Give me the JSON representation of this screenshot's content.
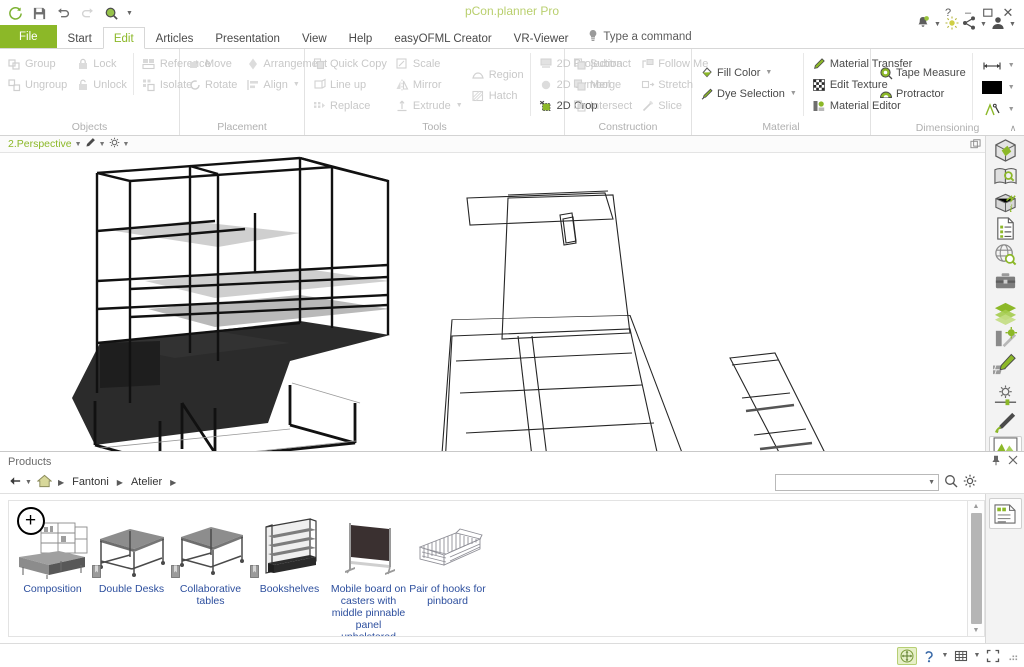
{
  "window": {
    "title": "pCon.planner Pro",
    "controls": {
      "help": "?",
      "minimize": "–",
      "maximize": "❐",
      "close": "✕"
    }
  },
  "quick_access": {
    "items": [
      {
        "name": "refresh-icon",
        "label": "Refresh"
      },
      {
        "name": "save-icon",
        "label": "Save"
      },
      {
        "name": "undo-icon",
        "label": "Undo"
      },
      {
        "name": "redo-icon",
        "label": "Redo"
      },
      {
        "name": "zoom-icon",
        "label": "Zoom"
      }
    ]
  },
  "account_bar": {
    "notifications": "Notifications",
    "tips": "Tips",
    "share": "Share",
    "account": "Account"
  },
  "tabs": [
    {
      "label": "File",
      "type": "file"
    },
    {
      "label": "Start",
      "type": "normal"
    },
    {
      "label": "Edit",
      "type": "active"
    },
    {
      "label": "Articles",
      "type": "normal"
    },
    {
      "label": "Presentation",
      "type": "normal"
    },
    {
      "label": "View",
      "type": "normal"
    },
    {
      "label": "Help",
      "type": "normal"
    },
    {
      "label": "easyOFML Creator",
      "type": "normal"
    },
    {
      "label": "VR-Viewer",
      "type": "normal"
    }
  ],
  "command_search": {
    "placeholder": "Type a command",
    "icon": "lightbulb-icon"
  },
  "ribbon": {
    "collapse_label": "∧",
    "groups": [
      {
        "title": "Objects",
        "columns": [
          {
            "items": [
              {
                "label": "Group",
                "icon": "group-icon",
                "disabled": true
              },
              {
                "label": "Ungroup",
                "icon": "ungroup-icon",
                "disabled": true
              }
            ]
          },
          {
            "items": [
              {
                "label": "Lock",
                "icon": "lock-icon",
                "disabled": true
              },
              {
                "label": "Unlock",
                "icon": "unlock-icon",
                "disabled": true
              }
            ]
          },
          {
            "sep": true,
            "items": [
              {
                "label": "Reference",
                "icon": "reference-icon",
                "disabled": true
              },
              {
                "label": "Isolate",
                "icon": "isolate-icon",
                "disabled": true
              }
            ]
          }
        ]
      },
      {
        "title": "Placement",
        "columns": [
          {
            "items": [
              {
                "label": "Move",
                "icon": "move-icon",
                "disabled": true
              },
              {
                "label": "Rotate",
                "icon": "rotate-icon",
                "disabled": true
              }
            ]
          },
          {
            "items": [
              {
                "label": "Arrangement",
                "icon": "arrangement-icon",
                "disabled": true
              },
              {
                "label": "Align",
                "icon": "align-icon",
                "disabled": true,
                "caret": true
              }
            ]
          }
        ]
      },
      {
        "title": "Tools",
        "columns": [
          {
            "items": [
              {
                "label": "Quick Copy",
                "icon": "quick-copy-icon",
                "disabled": true
              },
              {
                "label": "Line up",
                "icon": "line-up-icon",
                "disabled": true
              },
              {
                "label": "Replace",
                "icon": "replace-icon",
                "disabled": true
              }
            ]
          },
          {
            "items": [
              {
                "label": "Scale",
                "icon": "scale-icon",
                "disabled": true
              },
              {
                "label": "Mirror",
                "icon": "mirror-icon",
                "disabled": true
              },
              {
                "label": "Extrude",
                "icon": "extrude-icon",
                "disabled": true,
                "caret": true
              }
            ]
          },
          {
            "center": true,
            "items": [
              {
                "label": "Region",
                "icon": "region-icon",
                "disabled": true
              },
              {
                "label": "Hatch",
                "icon": "hatch-icon",
                "disabled": true
              }
            ]
          },
          {
            "sep": true,
            "items": [
              {
                "label": "2D Projection",
                "icon": "projection-icon",
                "disabled": true
              },
              {
                "label": "2D Symbol",
                "icon": "symbol-icon",
                "disabled": true
              },
              {
                "label": "2D Crop",
                "icon": "crop-icon",
                "disabled": false
              }
            ]
          }
        ]
      },
      {
        "title": "Construction",
        "columns": [
          {
            "items": [
              {
                "label": "Subtract",
                "icon": "subtract-icon",
                "disabled": true
              },
              {
                "label": "Merge",
                "icon": "merge-icon",
                "disabled": true
              },
              {
                "label": "Intersect",
                "icon": "intersect-icon",
                "disabled": true
              }
            ]
          },
          {
            "items": [
              {
                "label": "Follow Me",
                "icon": "follow-me-icon",
                "disabled": true
              },
              {
                "label": "Stretch",
                "icon": "stretch-icon",
                "disabled": true
              },
              {
                "label": "Slice",
                "icon": "slice-icon",
                "disabled": true
              }
            ]
          }
        ]
      },
      {
        "title": "Material",
        "columns": [
          {
            "center": true,
            "items": [
              {
                "label": "Fill Color",
                "icon": "fill-color-icon",
                "disabled": false,
                "caret": true
              },
              {
                "label": "Dye Selection",
                "icon": "dye-selection-icon",
                "disabled": false,
                "caret": true
              }
            ]
          },
          {
            "sep": true,
            "items": [
              {
                "label": "Material Transfer",
                "icon": "material-transfer-icon",
                "disabled": false
              },
              {
                "label": "Edit Texture",
                "icon": "edit-texture-icon",
                "disabled": false
              },
              {
                "label": "Material Editor",
                "icon": "material-editor-icon",
                "disabled": false
              }
            ]
          }
        ]
      },
      {
        "title": "Dimensioning",
        "columns": [
          {
            "center": true,
            "items": [
              {
                "label": "Tape Measure",
                "icon": "tape-measure-icon",
                "disabled": false
              },
              {
                "label": "Protractor",
                "icon": "protractor-icon",
                "disabled": false
              }
            ]
          },
          {
            "sep": true,
            "stack": true,
            "items": [
              {
                "label": "",
                "icon": "dimension-line-icon",
                "disabled": false,
                "caret": true
              },
              {
                "label": "",
                "icon": "color-swatch-black",
                "disabled": false,
                "caret": true
              },
              {
                "label": "",
                "icon": "dimension-style-icon",
                "disabled": false,
                "caret": true
              }
            ]
          }
        ]
      }
    ]
  },
  "viewport": {
    "name": "2.Perspective",
    "render_mode_icon": "pen-icon",
    "settings_icon": "gear-icon",
    "detach_icon": "detach-icon"
  },
  "vertical_toolbar": {
    "items": [
      {
        "name": "object-3d-icon",
        "label": "3D Objects"
      },
      {
        "name": "catalog-search-icon",
        "label": "Catalog Search"
      },
      {
        "name": "package-info-icon",
        "label": "Article Information"
      },
      {
        "name": "article-list-icon",
        "label": "Article List"
      },
      {
        "name": "online-catalog-icon",
        "label": "Online Catalog"
      },
      {
        "name": "toolbox-icon",
        "label": "Toolbox"
      },
      {
        "name": "layers-icon",
        "label": "Layers"
      },
      {
        "name": "media-icon",
        "label": "Media"
      },
      {
        "name": "texture-edit-icon",
        "label": "Texture Editing"
      },
      {
        "name": "light-slider-icon",
        "label": "Light Settings"
      },
      {
        "name": "render-pen-icon",
        "label": "Rendering"
      },
      {
        "name": "image-icon",
        "label": "Image"
      }
    ]
  },
  "products_panel": {
    "title": "Products",
    "pin_icon": "pin-icon",
    "close_icon": "close-icon",
    "nav": {
      "back_icon": "back-arrow-icon",
      "home_icon": "home-icon",
      "breadcrumbs": [
        "Fantoni",
        "Atelier"
      ]
    },
    "search": {
      "value": "",
      "placeholder": "",
      "search_icon": "search-icon",
      "settings_icon": "gear-icon"
    },
    "side_icon": {
      "name": "document-panel-icon",
      "label": "Document"
    },
    "items": [
      {
        "label": "Composition",
        "thumb": "composition-thumb",
        "badge": "+",
        "bookmark": false
      },
      {
        "label": "Double Desks",
        "thumb": "double-desk-thumb",
        "bookmark": true
      },
      {
        "label": "Collaborative tables",
        "thumb": "collaborative-table-thumb",
        "bookmark": true
      },
      {
        "label": "Bookshelves",
        "thumb": "bookshelf-thumb",
        "bookmark": true
      },
      {
        "label": "Mobile board on casters with middle pinnable panel upholstered",
        "thumb": "mobile-board-thumb",
        "bookmark": false
      },
      {
        "label": "Pair of hooks for pinboard",
        "thumb": "hooks-thumb",
        "bookmark": false
      }
    ]
  },
  "status_bar": {
    "buttons": [
      {
        "name": "pan-tool-button",
        "label": "Pan",
        "active": true,
        "caret": false
      },
      {
        "name": "orbit-tool-button",
        "label": "Orbit",
        "active": false,
        "caret": true
      },
      {
        "name": "grid-snap-button",
        "label": "Grid",
        "active": false,
        "caret": true
      },
      {
        "name": "fullscreen-button",
        "label": "Fullscreen",
        "active": false,
        "caret": false
      }
    ],
    "resize_grip": "resize-grip"
  },
  "colors": {
    "brand_green": "#8cb828",
    "title_green": "#b9cf6e",
    "link_blue": "#2d4f9e",
    "disabled_gray": "#c8c8c8",
    "panel_gray": "#f3f3f3"
  }
}
